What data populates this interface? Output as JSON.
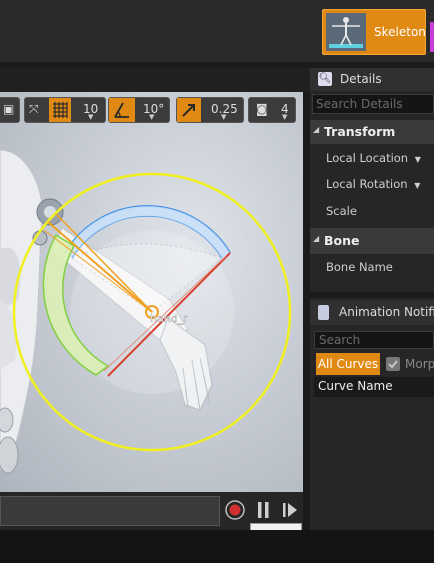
{
  "header": {
    "skeleton_button": {
      "label": "Skeleton",
      "icon": "skeleton-thumbnail-icon"
    },
    "accent_color": "#e08a14"
  },
  "viewport": {
    "toolbar": {
      "grid_snap_value": "10",
      "rotation_snap_value": "10°",
      "scale_snap_value": "0.25",
      "camera_speed_value": "4"
    },
    "bone_label": "hand_r",
    "gizmo_colors": {
      "ring": "#f0f020",
      "arc_x": "#d84030",
      "arc_y": "#80d040",
      "arc_z": "#3c8ce6",
      "bone": "#f0a020"
    }
  },
  "playback": {
    "record_tooltip": "Record",
    "record_icon": "record-icon",
    "pause_icon": "pause-icon",
    "step_icon": "step-forward-icon"
  },
  "details": {
    "title": "Details",
    "search_placeholder": "Search Details",
    "categories": [
      {
        "name": "Transform",
        "properties": [
          "Local Location",
          "Local Rotation",
          "Scale"
        ]
      },
      {
        "name": "Bone",
        "properties": [
          "Bone Name"
        ]
      }
    ]
  },
  "notifies": {
    "title": "Animation Notifie",
    "search_placeholder": "Search",
    "all_curves_label": "All Curves",
    "morph_label": "Morp",
    "curve_name_header": "Curve Name"
  }
}
